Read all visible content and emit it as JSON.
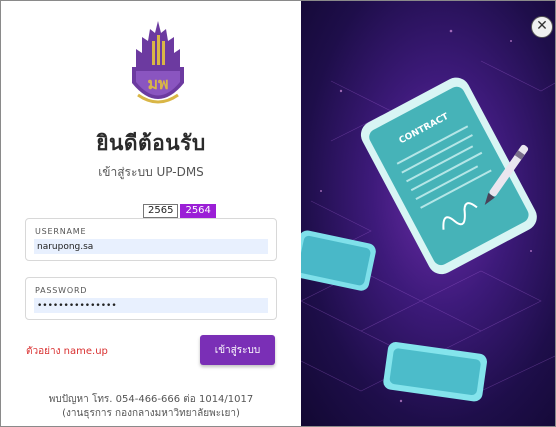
{
  "window": {
    "close_glyph": "✕"
  },
  "login": {
    "welcome": "ยินดีต้อนรับ",
    "subtitle": "เข้าสู่ระบบ UP-DMS",
    "years": [
      {
        "label": "2565",
        "selected": false
      },
      {
        "label": "2564",
        "selected": true
      }
    ],
    "username": {
      "label": "USERNAME",
      "value": "narupong.sa"
    },
    "password": {
      "label": "PASSWORD",
      "value": "•••••••••••••••"
    },
    "example": "ตัวอย่าง name.up",
    "submit_label": "เข้าสู่ระบบ",
    "contact_line1": "พบปัญหา โทร. 054-466-666 ต่อ 1014/1017",
    "contact_line2": "(งานธุรการ กองกลางมหาวิทยาลัยพะเยา)"
  },
  "illustration": {
    "phone_caption": "CONTRACT"
  },
  "colors": {
    "accent": "#7a2fb6",
    "year_selected": "#9b1fd6",
    "example_text": "#d93030",
    "panel_dark": "#1e0e4a"
  },
  "icons": [
    "university-logo",
    "close-icon",
    "pen-icon",
    "signature"
  ]
}
